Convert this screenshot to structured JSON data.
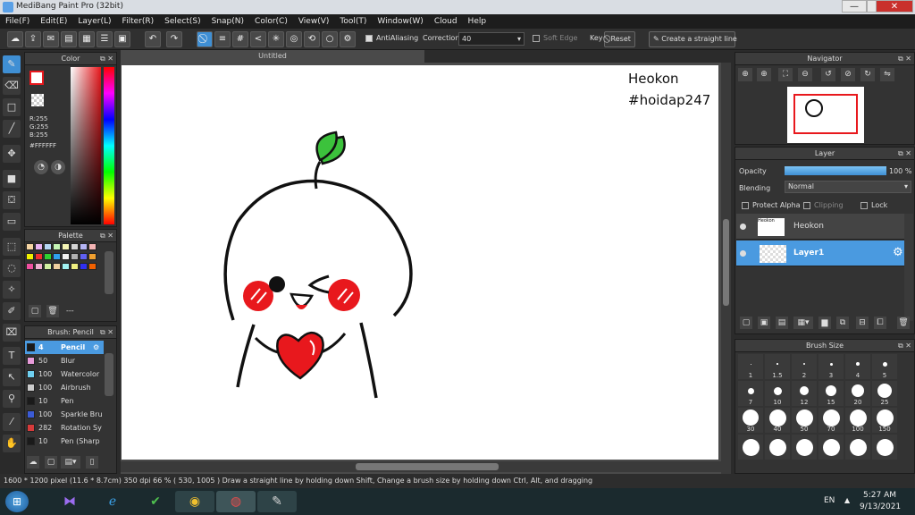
{
  "window": {
    "title": "MediBang Paint Pro (32bit)",
    "min": "—",
    "max": "❐",
    "close": "✕"
  },
  "menu": [
    "File(F)",
    "Edit(E)",
    "Layer(L)",
    "Filter(R)",
    "Select(S)",
    "Snap(N)",
    "Color(C)",
    "View(V)",
    "Tool(T)",
    "Window(W)",
    "Cloud",
    "Help"
  ],
  "toolbar": {
    "antialiasing": "AntiAliasing",
    "correction_label": "Correction",
    "correction_value": "40",
    "soft_edge": "Soft Edge",
    "key_label": "Key",
    "reset": "Reset",
    "straight_line": "Create a straight line"
  },
  "color_panel": {
    "title": "Color",
    "r": "R:255",
    "g": "G:255",
    "b": "B:255",
    "hex": "#FFFFFF"
  },
  "palette_panel": {
    "title": "Palette",
    "more": "---"
  },
  "brush_panel": {
    "title": "Brush: Pencil",
    "items": [
      {
        "size": "4",
        "name": "Pencil",
        "color": "#1a1a1a"
      },
      {
        "size": "50",
        "name": "Blur",
        "color": "#e79bd9"
      },
      {
        "size": "100",
        "name": "Watercolor",
        "color": "#6fd0f0"
      },
      {
        "size": "100",
        "name": "Airbrush",
        "color": "#cccccc"
      },
      {
        "size": "10",
        "name": "Pen",
        "color": "#1a1a1a"
      },
      {
        "size": "100",
        "name": "Sparkle Bru",
        "color": "#3b5bd6"
      },
      {
        "size": "282",
        "name": "Rotation Sy",
        "color": "#d63b3b"
      },
      {
        "size": "10",
        "name": "Pen (Sharp",
        "color": "#1a1a1a"
      }
    ]
  },
  "canvas": {
    "tab": "Untitled",
    "text1": "Heokon",
    "text2": "#hoidap247"
  },
  "navigator": {
    "title": "Navigator"
  },
  "layer_panel": {
    "title": "Layer",
    "opacity_label": "Opacity",
    "opacity_value": "100 %",
    "opacity": 1.0,
    "blending_label": "Blending",
    "blending_value": "Normal",
    "protect_alpha": "Protect Alpha",
    "clipping": "Clipping",
    "lock": "Lock",
    "layers": [
      {
        "name": "Heokon",
        "selected": false
      },
      {
        "name": "Layer1",
        "selected": true
      }
    ]
  },
  "brush_size": {
    "title": "Brush Size",
    "sizes": [
      "1",
      "1.5",
      "2",
      "3",
      "4",
      "5",
      "7",
      "10",
      "12",
      "15",
      "20",
      "25",
      "30",
      "40",
      "50",
      "70",
      "100",
      "150"
    ]
  },
  "status": {
    "text": "1600 * 1200 pixel   (11.6 * 8.7cm)   350 dpi   66 %   ( 530, 1005 )   Draw a straight line by holding down Shift, Change a brush size by holding down Ctrl, Alt, and dragging"
  },
  "taskbar": {
    "lang": "EN",
    "time": "5:27 AM",
    "date": "9/13/2021"
  },
  "colors": {
    "accent": "#3f8fd4",
    "blush": "#e8181d",
    "leaf": "#3cc23c"
  }
}
